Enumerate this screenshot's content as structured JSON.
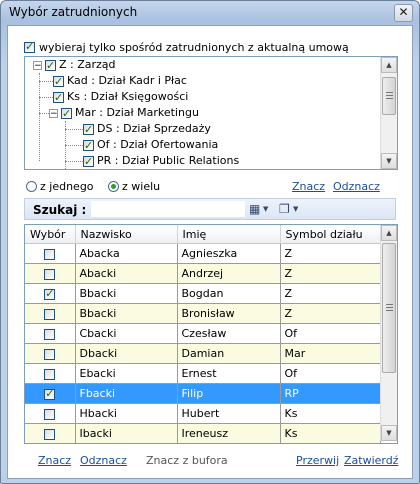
{
  "window": {
    "title": "Wybór zatrudnionych",
    "close_glyph": "✕"
  },
  "only_current": {
    "label": "wybieraj tylko spośród zatrudnionych z aktualną umową",
    "checked": true
  },
  "tree": [
    {
      "label": "Z : Zarząd",
      "checked": true,
      "expander": "−"
    },
    {
      "label": "Kad : Dział Kadr i Płac",
      "checked": true
    },
    {
      "label": "Ks : Dział Księgowości",
      "checked": true
    },
    {
      "label": "Mar : Dział Marketingu",
      "checked": true,
      "expander": "−"
    },
    {
      "label": "DS : Dział Sprzedaży",
      "checked": true
    },
    {
      "label": "Of : Dział Ofertowania",
      "checked": true
    },
    {
      "label": "PR : Dział Public Relations",
      "checked": true
    }
  ],
  "mode": {
    "single_label": "z jednego",
    "multi_label": "z wielu",
    "selected": "multi"
  },
  "tree_links": {
    "mark": "Znacz",
    "unmark": "Odznacz"
  },
  "search": {
    "label": "Szukaj :",
    "value": "",
    "table_icon": "table-icon",
    "copy_icon": "copy-icon"
  },
  "grid": {
    "columns": [
      "Wybór",
      "Nazwisko",
      "Imię",
      "Symbol działu"
    ],
    "rows": [
      {
        "checked": false,
        "surname": "Abacka",
        "name": "Agnieszka",
        "dept": "Z"
      },
      {
        "checked": false,
        "surname": "Abacki",
        "name": "Andrzej",
        "dept": "Z"
      },
      {
        "checked": true,
        "surname": "Bbacki",
        "name": "Bogdan",
        "dept": "Z"
      },
      {
        "checked": false,
        "surname": "Bbacki",
        "name": "Bronisław",
        "dept": "Z"
      },
      {
        "checked": false,
        "surname": "Cbacki",
        "name": "Czesław",
        "dept": "Of"
      },
      {
        "checked": false,
        "surname": "Dbacki",
        "name": "Damian",
        "dept": "Mar"
      },
      {
        "checked": false,
        "surname": "Ebacki",
        "name": "Ernest",
        "dept": "Of"
      },
      {
        "checked": true,
        "surname": "Fbacki",
        "name": "Filip",
        "dept": "RP",
        "selected": true
      },
      {
        "checked": false,
        "surname": "Hbacki",
        "name": "Hubert",
        "dept": "Ks"
      },
      {
        "checked": false,
        "surname": "Ibacki",
        "name": "Ireneusz",
        "dept": "Ks"
      }
    ]
  },
  "footer": {
    "mark": "Znacz",
    "unmark": "Odznacz",
    "from_buffer": "Znacz z bufora",
    "cancel": "Przerwij",
    "confirm": "Zatwierdź"
  }
}
